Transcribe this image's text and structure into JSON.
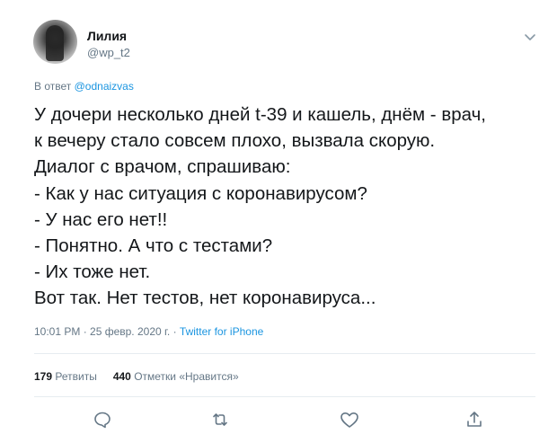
{
  "author": {
    "name": "Лилия",
    "handle": "@wp_t2"
  },
  "reply": {
    "prefix": "В ответ",
    "mention": "@odnaizvas"
  },
  "tweet_lines": [
    "У дочери несколько дней t-39 и кашель, днём - врач,",
    "к вечеру стало совсем плохо, вызвала скорую.",
    "Диалог с врачом, спрашиваю:",
    "- Как у нас ситуация с коронавирусом?",
    "- У нас его нет!!",
    "- Понятно. А что с тестами?",
    "- Их тоже нет.",
    "Вот так. Нет тестов, нет коронавируса..."
  ],
  "meta": {
    "time": "10:01 PM · 25 февр. 2020 г. · ",
    "source": "Twitter for iPhone"
  },
  "stats": {
    "retweets_count": "179",
    "retweets_label": "Ретвиты",
    "likes_count": "440",
    "likes_label": "Отметки «Нравится»"
  },
  "icons": {
    "reply": "reply-icon",
    "retweet": "retweet-icon",
    "like": "like-icon",
    "share": "share-icon",
    "caret": "chevron-down-icon"
  },
  "colors": {
    "link": "#1b95e0",
    "muted": "#657786",
    "text": "#14171a",
    "divider": "#e6ecf0"
  }
}
